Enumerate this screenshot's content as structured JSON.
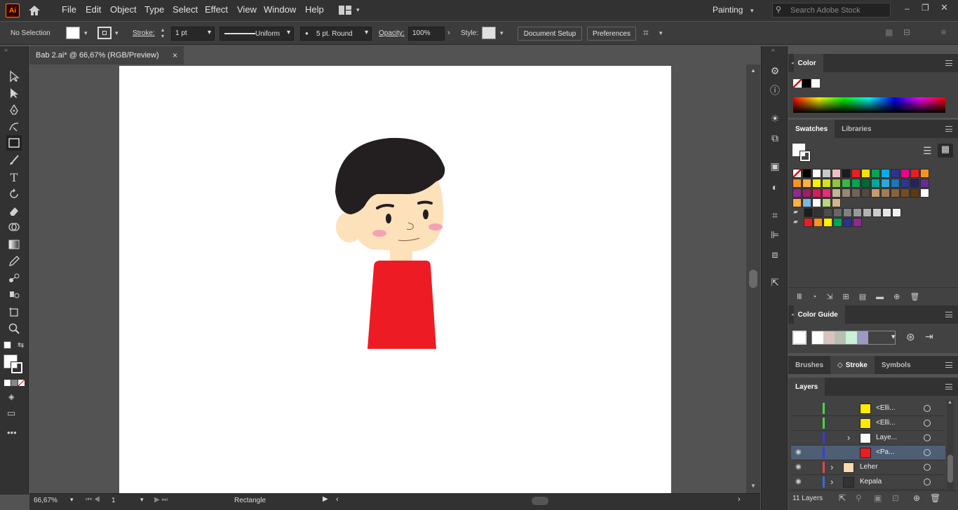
{
  "app": {
    "logo": "Ai",
    "menus": [
      "File",
      "Edit",
      "Object",
      "Type",
      "Select",
      "Effect",
      "View",
      "Window",
      "Help"
    ],
    "workspace": "Painting",
    "search_placeholder": "Search Adobe Stock"
  },
  "control_bar": {
    "selection": "No Selection",
    "stroke_label": "Stroke:",
    "stroke_weight": "1 pt",
    "profile": "Uniform",
    "brush": "5 pt. Round",
    "opacity_label": "Opacity:",
    "opacity": "100%",
    "style_label": "Style:",
    "document_setup": "Document Setup",
    "preferences": "Preferences"
  },
  "document": {
    "tab_title": "Bab 2.ai* @ 66,67% (RGB/Preview)",
    "close": "×"
  },
  "status": {
    "zoom": "66,67%",
    "artboard": "1",
    "tool_name": "Rectangle"
  },
  "panels": {
    "color": {
      "title": "Color"
    },
    "swatches": {
      "tabs": [
        "Swatches",
        "Libraries"
      ]
    },
    "color_guide": {
      "title": "Color Guide"
    },
    "stroke_group": {
      "tabs": [
        "Brushes",
        "Stroke",
        "Symbols"
      ]
    },
    "layers": {
      "title": "Layers",
      "rows": [
        {
          "name": "<Elli...",
          "color": "#ffea00",
          "bar": "#44d944",
          "selected": false,
          "eye": "",
          "expand": ""
        },
        {
          "name": "<Elli...",
          "color": "#ffea00",
          "bar": "#44d944",
          "selected": false,
          "eye": "",
          "expand": ""
        },
        {
          "name": "Laye...",
          "color": "#ffffff",
          "bar": "#3b3bd9",
          "selected": false,
          "eye": "",
          "expand": "›"
        },
        {
          "name": "<Pa...",
          "color": "#ed1c24",
          "bar": "#3b3bd9",
          "selected": true,
          "eye": "◉",
          "expand": ""
        },
        {
          "name": "Leher",
          "color": "#fcd9b0",
          "bar": "#e04848",
          "selected": false,
          "eye": "◉",
          "expand": "›"
        },
        {
          "name": "Kepala",
          "color": "#333333",
          "bar": "#3b6bd9",
          "selected": false,
          "eye": "◉",
          "expand": "›"
        }
      ],
      "count": "11 Layers"
    }
  },
  "colors": {
    "accent": "#ed1c24",
    "hair": "#231f20",
    "skin": "#fde1bb",
    "cheek": "#f6a0b5"
  },
  "swatch_rows": [
    [
      "#ffffff",
      "#000000",
      "#ffffff",
      "#c8c8c8",
      "#f0c0c0",
      "#1c1c1c",
      "#ed1c24",
      "#ffde00",
      "#00a651",
      "#00aeef",
      "#2e3192",
      "#ec008c",
      "#ed1c24",
      "#f7941d"
    ],
    [
      "#f7941d",
      "#fbb040",
      "#fff200",
      "#d7df23",
      "#8dc63f",
      "#39b54a",
      "#00a651",
      "#006838",
      "#00a99d",
      "#27aae1",
      "#1c75bc",
      "#2b388f",
      "#262262",
      "#662d91"
    ],
    [
      "#92278f",
      "#9e1f63",
      "#da1c5c",
      "#ee2a7b",
      "#c2b59b",
      "#998675",
      "#736357",
      "#534741",
      "#c69c6d",
      "#a67c52",
      "#8c6239",
      "#754c24",
      "#603913",
      "#ffffff"
    ],
    [
      "#fbb040",
      "#7ab8e6",
      "#ffffff",
      "#b8d67a",
      "#d6b48a"
    ],
    [
      "#1c1c1c",
      "#333333",
      "#4d4d4d",
      "#666666",
      "#808080",
      "#999999",
      "#b3b3b3",
      "#cccccc",
      "#e6e6e6",
      "#f2f2f2"
    ],
    [
      "#ed1c24",
      "#f7941d",
      "#fff200",
      "#00a651",
      "#2e3192",
      "#92278f"
    ]
  ],
  "guide_colors": [
    "#ffffff",
    "#d9c4bd",
    "#b7bfb2",
    "#c9f0d8",
    "#9a9ac4"
  ]
}
